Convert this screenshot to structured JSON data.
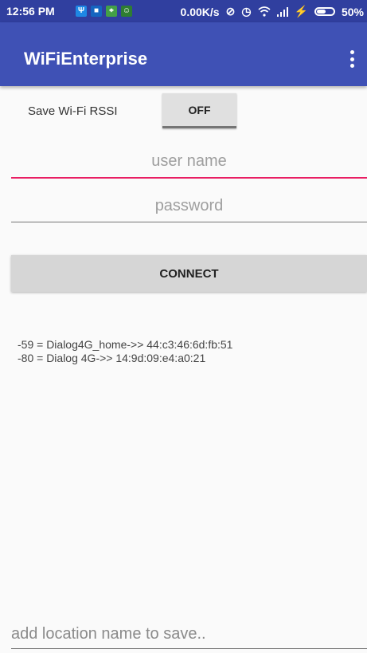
{
  "status_bar": {
    "time": "12:56 PM",
    "network_speed": "0.00K/s",
    "battery": "50%",
    "battery_level": 0.5,
    "icons": [
      "usb-icon",
      "app-notification-icon",
      "maps-icon",
      "android-icon",
      "nfc-icon",
      "alarm-icon",
      "wifi-icon",
      "signal-icon",
      "charging-icon",
      "battery-icon"
    ]
  },
  "app_bar": {
    "title": "WiFiEnterprise",
    "menu_icon": "overflow-menu-icon",
    "color": "#3f51b5"
  },
  "rssi": {
    "label": "Save Wi-Fi RSSI",
    "toggle_label": "OFF"
  },
  "form": {
    "username_placeholder": "user name",
    "password_placeholder": "password",
    "connect_label": "CONNECT",
    "focus_color": "#e91e63"
  },
  "results": [
    "-59 = Dialog4G_home->> 44:c3:46:6d:fb:51",
    "-80 = Dialog 4G->> 14:9d:09:e4:a0:21"
  ],
  "location": {
    "placeholder": "add location name to save.."
  }
}
